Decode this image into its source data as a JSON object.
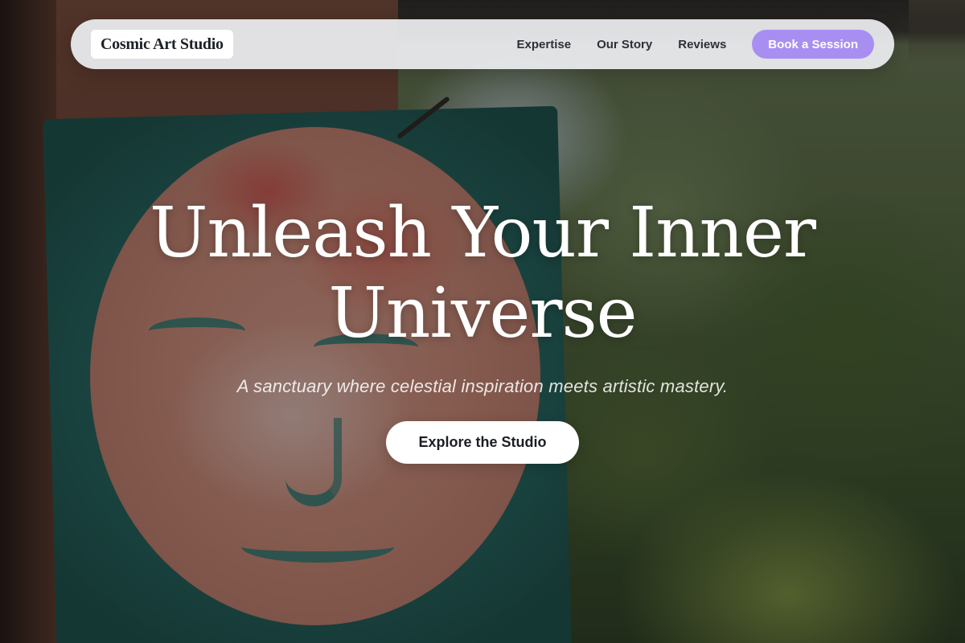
{
  "nav": {
    "brand": "Cosmic Art Studio",
    "links": [
      {
        "label": "Expertise"
      },
      {
        "label": "Our Story"
      },
      {
        "label": "Reviews"
      }
    ],
    "cta_label": "Book a Session"
  },
  "hero": {
    "title_line1": "Unleash Your Inner",
    "title_line2": "Universe",
    "subtitle": "A sanctuary where celestial inspiration meets artistic mastery.",
    "button_label": "Explore the Studio"
  },
  "colors": {
    "accent": "#a98ef2",
    "nav_background": "#eeeff2",
    "hero_text": "#ffffff",
    "button_background": "#ffffff"
  }
}
